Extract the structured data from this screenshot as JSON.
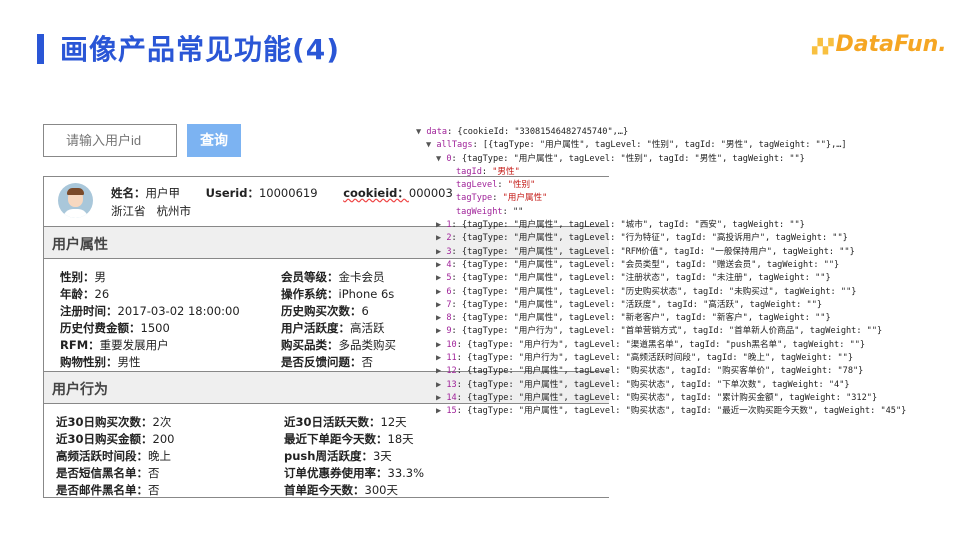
{
  "title": "画像产品常见功能(4)",
  "logo": "DataFun.",
  "search": {
    "placeholder": "请输入用户id",
    "button": "查询"
  },
  "profile": {
    "name_label": "姓名：",
    "name": "用户甲",
    "userid_label": "Userid：",
    "userid": "10000619",
    "cookieid_label": "cookieid：",
    "cookieid": "000003",
    "location": "浙江省   杭州市"
  },
  "attr_section": "用户属性",
  "attrs": [
    [
      "性别：",
      "男",
      "会员等级：",
      "金卡会员"
    ],
    [
      "年龄：",
      "26",
      "操作系统：",
      "iPhone 6s"
    ],
    [
      "注册时间：",
      "2017-03-02 18:00:00",
      "历史购买次数：",
      "6"
    ],
    [
      "历史付费金额：",
      "1500",
      "用户活跃度：",
      "高活跃"
    ],
    [
      "RFM：",
      "重要发展用户",
      "购买品类：",
      "多品类购买"
    ],
    [
      "购物性别：",
      "男性",
      "是否反馈问题：",
      "否"
    ]
  ],
  "behavior_section": "用户行为",
  "behaviors": [
    [
      "近30日购买次数：",
      "2次",
      "近30日活跃天数：",
      "12天"
    ],
    [
      "近30日购买金额：",
      "200",
      "最近下单距今天数：",
      "18天"
    ],
    [
      "高频活跃时间段：",
      "晚上",
      "push周活跃度：",
      "3天"
    ],
    [
      "是否短信黑名单：",
      "否",
      "订单优惠券使用率：",
      "33.3%"
    ],
    [
      "是否邮件黑名单：",
      "否",
      "首单距今天数：",
      "300天"
    ]
  ],
  "console": {
    "data_line": "data: {cookieId: \"33081546482745740\",…}",
    "alltags_line": "allTags: [{tagType: \"用户属性\", tagLevel: \"性别\", tagId: \"男性\", tagWeight: \"\"},…]",
    "expanded": {
      "index": "0",
      "tagId": "\"男性\"",
      "tagLevel": "\"性别\"",
      "tagType": "\"用户属性\"",
      "tagWeight": "\"\""
    },
    "tags": [
      [
        "0",
        "用户属性",
        "性别",
        "男性",
        ""
      ],
      [
        "1",
        "用户属性",
        "城市",
        "西安",
        ""
      ],
      [
        "2",
        "用户属性",
        "行为特征",
        "高投诉用户",
        ""
      ],
      [
        "3",
        "用户属性",
        "RFM价值",
        "一般保持用户",
        ""
      ],
      [
        "4",
        "用户属性",
        "会员类型",
        "赠送会员",
        ""
      ],
      [
        "5",
        "用户属性",
        "注册状态",
        "未注册",
        ""
      ],
      [
        "6",
        "用户属性",
        "历史购买状态",
        "未购买过",
        ""
      ],
      [
        "7",
        "用户属性",
        "活跃度",
        "高活跃",
        ""
      ],
      [
        "8",
        "用户属性",
        "新老客户",
        "新客户",
        ""
      ],
      [
        "9",
        "用户行为",
        "首单营销方式",
        "首单新人价商品",
        ""
      ],
      [
        "10",
        "用户行为",
        "渠道黑名单",
        "push黑名单",
        ""
      ],
      [
        "11",
        "用户行为",
        "高频活跃时间段",
        "晚上",
        ""
      ],
      [
        "12",
        "用户属性",
        "购买状态",
        "购买客单价",
        "78"
      ],
      [
        "13",
        "用户属性",
        "购买状态",
        "下单次数",
        "4"
      ],
      [
        "14",
        "用户属性",
        "购买状态",
        "累计购买金额",
        "312"
      ],
      [
        "15",
        "用户属性",
        "购买状态",
        "最近一次购买距今天数",
        "45"
      ]
    ]
  }
}
